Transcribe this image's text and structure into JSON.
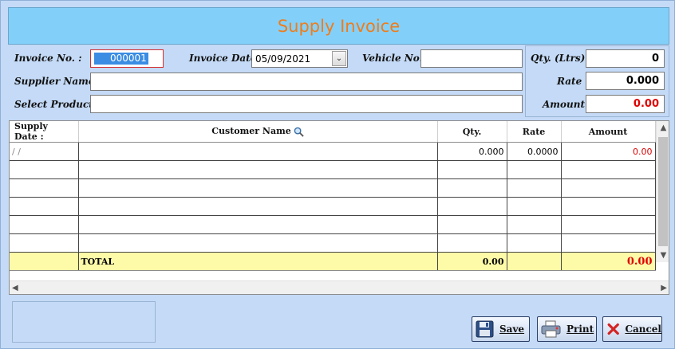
{
  "title": "Supply Invoice",
  "form": {
    "invoice_no_label": "Invoice No. :",
    "invoice_no_value": "000001",
    "invoice_date_label": "Invoice Date :",
    "invoice_date_value": "05/09/2021",
    "vehicle_no_label": "Vehicle No. :",
    "vehicle_no_value": "",
    "supplier_name_label": "Supplier Name :",
    "supplier_name_value": "",
    "select_product_label": "Select Product :",
    "select_product_value": ""
  },
  "summary": {
    "qty_label": "Qty. (Ltrs) :",
    "qty_value": "0",
    "rate_label": "Rate :",
    "rate_value": "0.000",
    "amount_label": "Amount :",
    "amount_value": "0.00"
  },
  "grid": {
    "columns": [
      "Supply Date :",
      "Customer Name",
      "Qty.",
      "Rate",
      "Amount"
    ],
    "first_row": {
      "date": "/ /",
      "customer": "",
      "qty": "0.000",
      "rate": "0.0000",
      "amount": "0.00"
    },
    "total": {
      "label": "TOTAL",
      "qty": "0.00",
      "amount": "0.00"
    }
  },
  "buttons": {
    "save": "Save",
    "print": "Print",
    "cancel": "Cancel"
  },
  "icons": {
    "search": "magnifier-icon",
    "save": "floppy-disk-icon",
    "print": "printer-icon",
    "cancel": "red-x-icon"
  },
  "colors": {
    "title_bg": "#82d0fa",
    "title_text": "#f07c1a",
    "window_bg": "#c4daf6",
    "total_row_bg": "#fefba8",
    "amount_red": "#e00000"
  }
}
